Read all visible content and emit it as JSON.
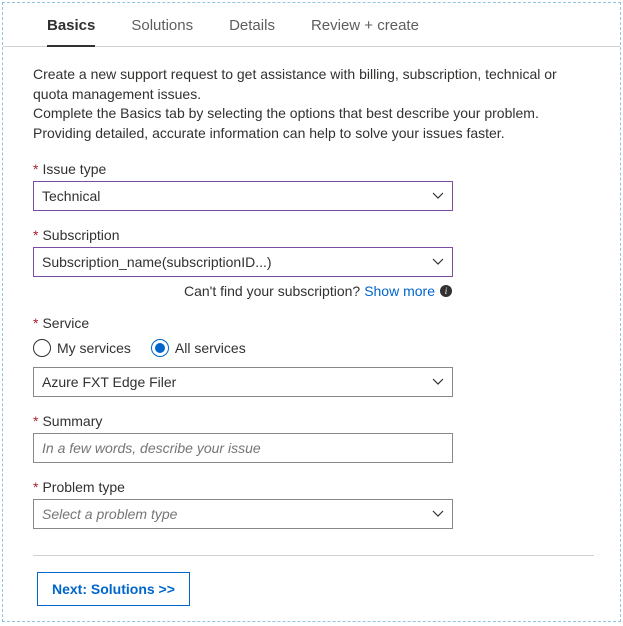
{
  "tabs": {
    "basics": "Basics",
    "solutions": "Solutions",
    "details": "Details",
    "review": "Review + create"
  },
  "intro": {
    "line1": "Create a new support request to get assistance with billing, subscription, technical or quota management issues.",
    "line2": "Complete the Basics tab by selecting the options that best describe your problem. Providing detailed, accurate information can help to solve your issues faster."
  },
  "fields": {
    "issue_type": {
      "label": "Issue type",
      "value": "Technical"
    },
    "subscription": {
      "label": "Subscription",
      "value": "Subscription_name(subscriptionID...)",
      "help_text": "Can't find your subscription?",
      "help_link": "Show more"
    },
    "service": {
      "label": "Service",
      "option_my": "My services",
      "option_all": "All services",
      "value": "Azure FXT Edge Filer"
    },
    "summary": {
      "label": "Summary",
      "placeholder": "In a few words, describe your issue"
    },
    "problem_type": {
      "label": "Problem type",
      "placeholder": "Select a problem type"
    }
  },
  "footer": {
    "next_button": "Next: Solutions >>"
  }
}
